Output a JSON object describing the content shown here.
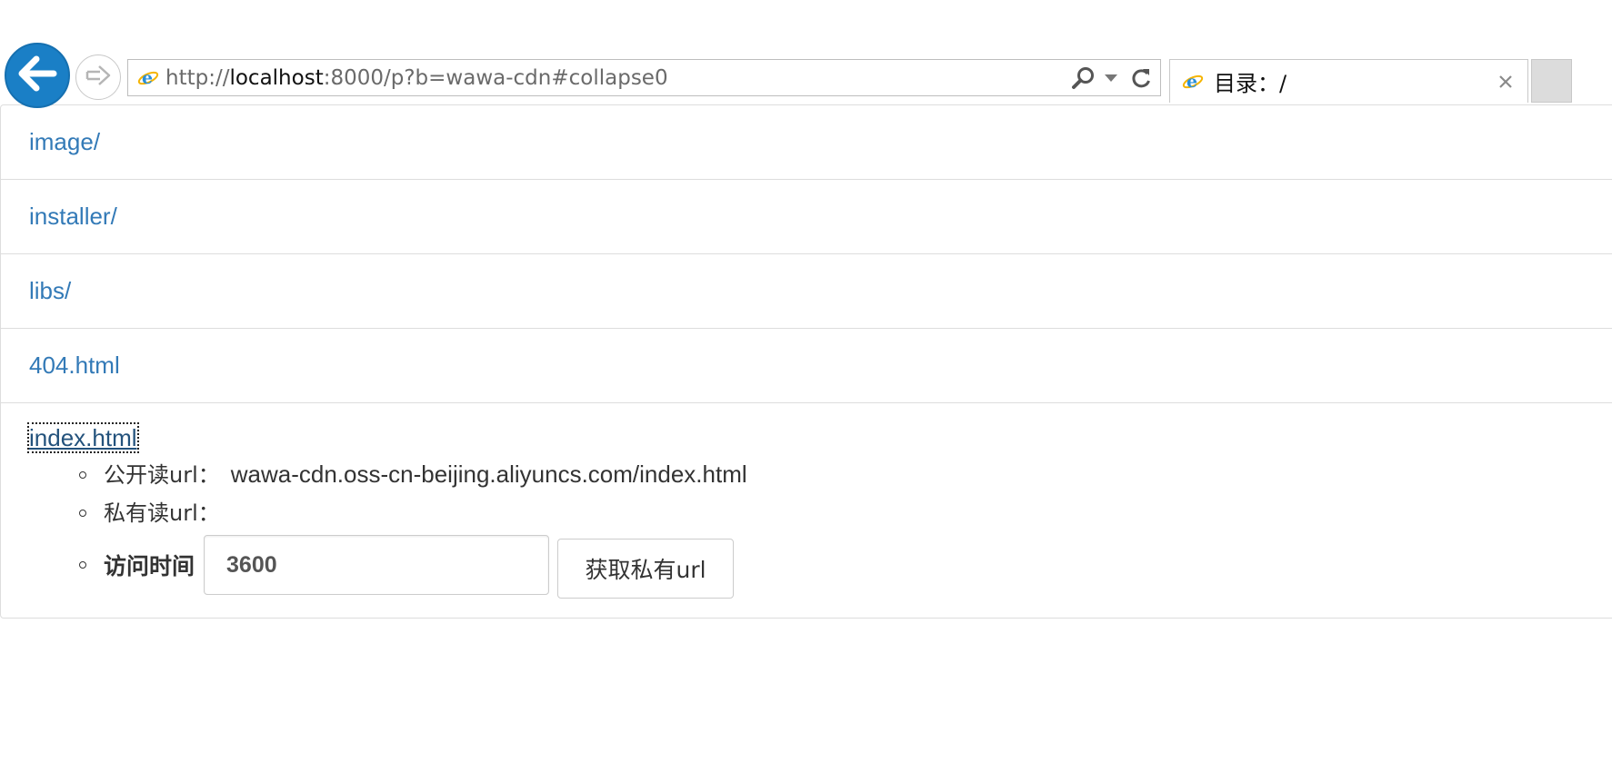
{
  "browser": {
    "address_url_prefix": "http://",
    "address_host": "localhost",
    "address_url_suffix": ":8000/p?b=wawa-cdn#collapse0",
    "tab_title": "目录：/",
    "accent_color": "#1a7fc6"
  },
  "file_list": {
    "items": [
      {
        "label": "image/"
      },
      {
        "label": "installer/"
      },
      {
        "label": "libs/"
      },
      {
        "label": "404.html"
      }
    ],
    "expanded": {
      "label": "index.html",
      "public_url_label": "公开读url：",
      "public_url_value": "wawa-cdn.oss-cn-beijing.aliyuncs.com/index.html",
      "private_url_label": "私有读url：",
      "access_time_label": "访问时间",
      "access_time_value": "3600",
      "get_private_url_button": "获取私有url"
    },
    "link_color": "#337ab7"
  }
}
